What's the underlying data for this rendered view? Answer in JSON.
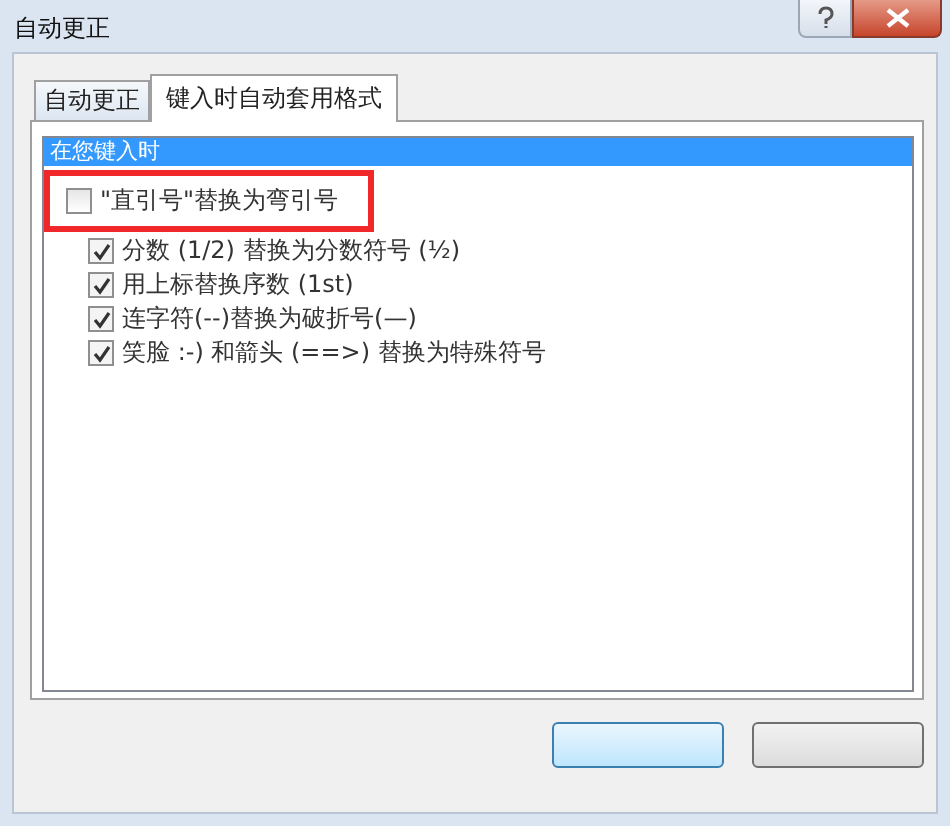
{
  "window": {
    "title": "自动更正"
  },
  "tabs": [
    {
      "label": "自动更正",
      "selected": false
    },
    {
      "label": "键入时自动套用格式",
      "selected": true
    }
  ],
  "list": {
    "header": "在您键入时",
    "items": [
      {
        "label": "\"直引号\"替换为弯引号",
        "checked": false,
        "highlighted": true
      },
      {
        "label": "分数 (1/2) 替换为分数符号 (½)",
        "checked": true,
        "highlighted": false
      },
      {
        "label": "用上标替换序数 (1st)",
        "checked": true,
        "highlighted": false
      },
      {
        "label": "连字符(--)替换为破折号(—)",
        "checked": true,
        "highlighted": false
      },
      {
        "label": "笑脸 :-) 和箭头 (==>) 替换为特殊符号",
        "checked": true,
        "highlighted": false
      }
    ]
  },
  "buttons": [
    {
      "kind": "blank"
    },
    {
      "kind": "blank"
    }
  ]
}
